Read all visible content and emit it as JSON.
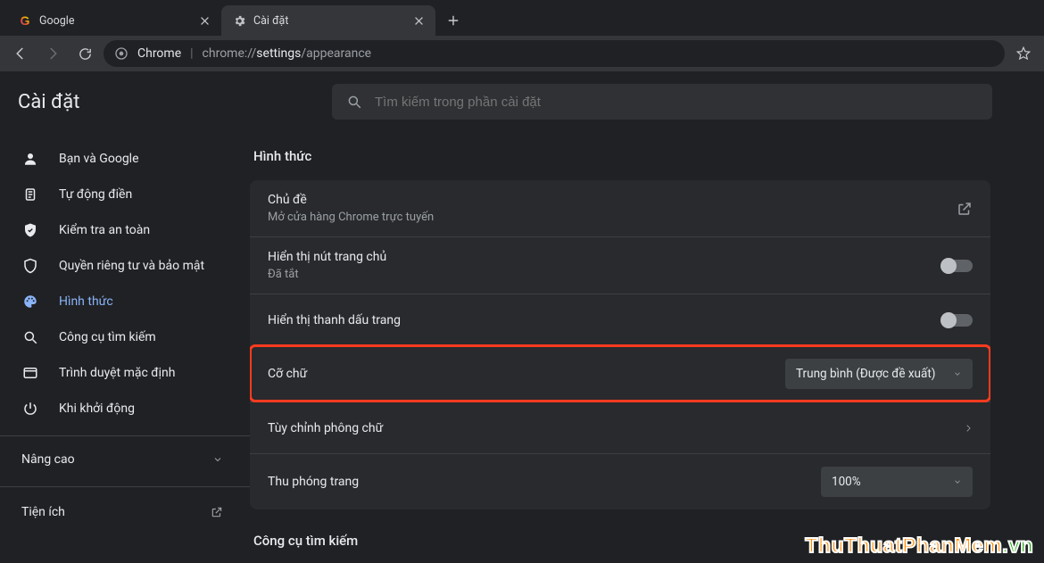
{
  "tabs": {
    "t0": {
      "label": "Google"
    },
    "t1": {
      "label": "Cài đặt"
    }
  },
  "omnibox": {
    "scheme_label": "Chrome",
    "url_dim1": "chrome://",
    "url_hi": "settings",
    "url_dim2": "/appearance"
  },
  "page_title": "Cài đặt",
  "search_placeholder": "Tìm kiếm trong phần cài đặt",
  "sidebar": {
    "items": [
      {
        "label": "Bạn và Google"
      },
      {
        "label": "Tự động điền"
      },
      {
        "label": "Kiểm tra an toàn"
      },
      {
        "label": "Quyền riêng tư và bảo mật"
      },
      {
        "label": "Hình thức"
      },
      {
        "label": "Công cụ tìm kiếm"
      },
      {
        "label": "Trình duyệt mặc định"
      },
      {
        "label": "Khi khởi động"
      }
    ],
    "advanced": "Nâng cao",
    "extensions": "Tiện ích"
  },
  "section": {
    "appearance_heading": "Hình thức",
    "rows": {
      "theme": {
        "title": "Chủ đề",
        "subtitle": "Mở cửa hàng Chrome trực tuyến"
      },
      "home_button": {
        "title": "Hiển thị nút trang chủ",
        "subtitle": "Đã tắt"
      },
      "bookmarks_bar": {
        "title": "Hiển thị thanh dấu trang"
      },
      "font_size": {
        "title": "Cỡ chữ",
        "value": "Trung bình (Được đề xuất)"
      },
      "customize_fonts": {
        "title": "Tùy chỉnh phông chữ"
      },
      "page_zoom": {
        "title": "Thu phóng trang",
        "value": "100%"
      }
    },
    "search_engine_heading": "Công cụ tìm kiếm"
  },
  "watermark": {
    "a": "ThuThuatPhanMem",
    "b": ".vn"
  }
}
